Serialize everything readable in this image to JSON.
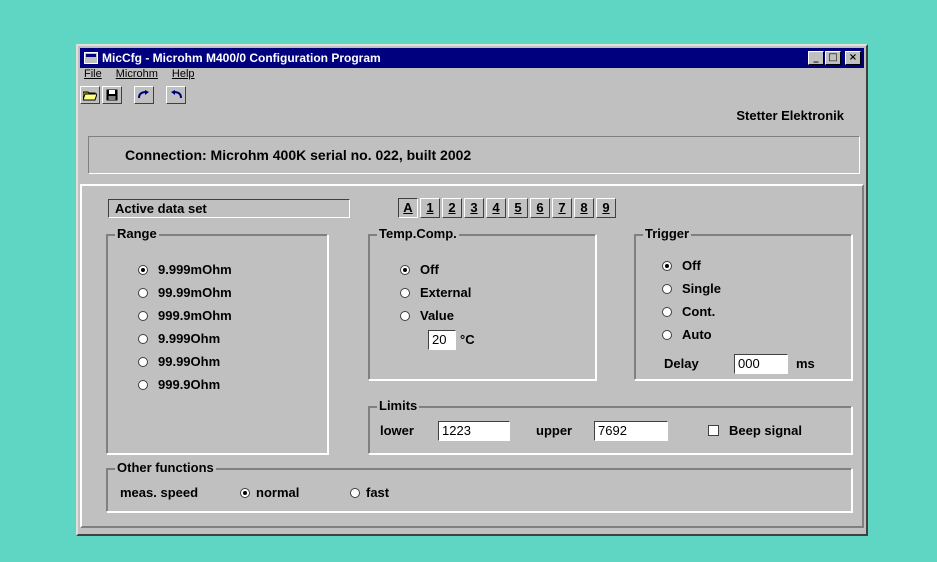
{
  "window": {
    "title": "MicCfg - Microhm M400/0 Configuration Program"
  },
  "title_buttons": {
    "minimize": "_",
    "maximize": "□",
    "close": "×"
  },
  "menu": [
    "File",
    "Microhm",
    "Help"
  ],
  "toolbar": {
    "icons": [
      "open-folder-icon",
      "save-disk-icon",
      "redo-icon",
      "undo-icon"
    ]
  },
  "company": "Stetter Elektronik",
  "connection": "Connection:  Microhm 400K  serial no. 022, built 2002",
  "active_data_set": "Active data set",
  "tabs": [
    "A",
    "1",
    "2",
    "3",
    "4",
    "5",
    "6",
    "7",
    "8",
    "9"
  ],
  "active_tab": "A",
  "range": {
    "label": "Range",
    "options": [
      "9.999mOhm",
      "99.99mOhm",
      "999.9mOhm",
      "9.999Ohm",
      "99.99Ohm",
      "999.9Ohm"
    ],
    "selected": "9.999mOhm"
  },
  "temp_comp": {
    "label": "Temp.Comp.",
    "options": [
      "Off",
      "External",
      "Value"
    ],
    "selected": "Off",
    "value": "20",
    "unit": "°C"
  },
  "trigger": {
    "label": "Trigger",
    "options": [
      "Off",
      "Single",
      "Cont.",
      "Auto"
    ],
    "selected": "Off",
    "delay_label": "Delay",
    "delay_value": "000",
    "delay_unit": "ms"
  },
  "limits": {
    "label": "Limits",
    "lower_label": "lower",
    "lower_value": "1223",
    "upper_label": "upper",
    "upper_value": "7692",
    "beep_label": "Beep signal",
    "beep_checked": false
  },
  "other": {
    "label": "Other functions",
    "speed_label": "meas. speed",
    "options": [
      "normal",
      "fast"
    ],
    "selected": "normal"
  }
}
